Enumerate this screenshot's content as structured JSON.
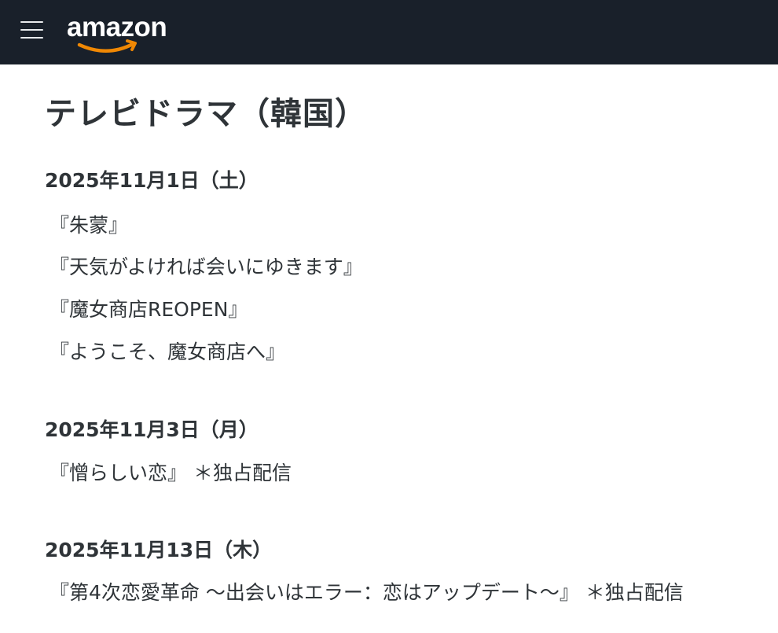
{
  "header": {
    "logo_text": "amazon",
    "menu_icon": "hamburger-icon"
  },
  "page_title": "テレビドラマ（韓国）",
  "sections": [
    {
      "date": "2025年11月1日（土）",
      "items": [
        "『朱蒙』",
        "『天気がよければ会いにゆきます』",
        "『魔女商店REOPEN』",
        "『ようこそ、魔女商店へ』"
      ]
    },
    {
      "date": "2025年11月3日（月）",
      "items": [
        "『憎らしい恋』 ＊独占配信"
      ]
    },
    {
      "date": "2025年11月13日（木）",
      "items": [
        "『第4次恋愛革命 〜出会いはエラー：恋はアップデート〜』 ＊独占配信"
      ]
    }
  ],
  "colors": {
    "topbar": "#19202a",
    "logo_smile": "#f08804",
    "text": "#2f3438"
  }
}
